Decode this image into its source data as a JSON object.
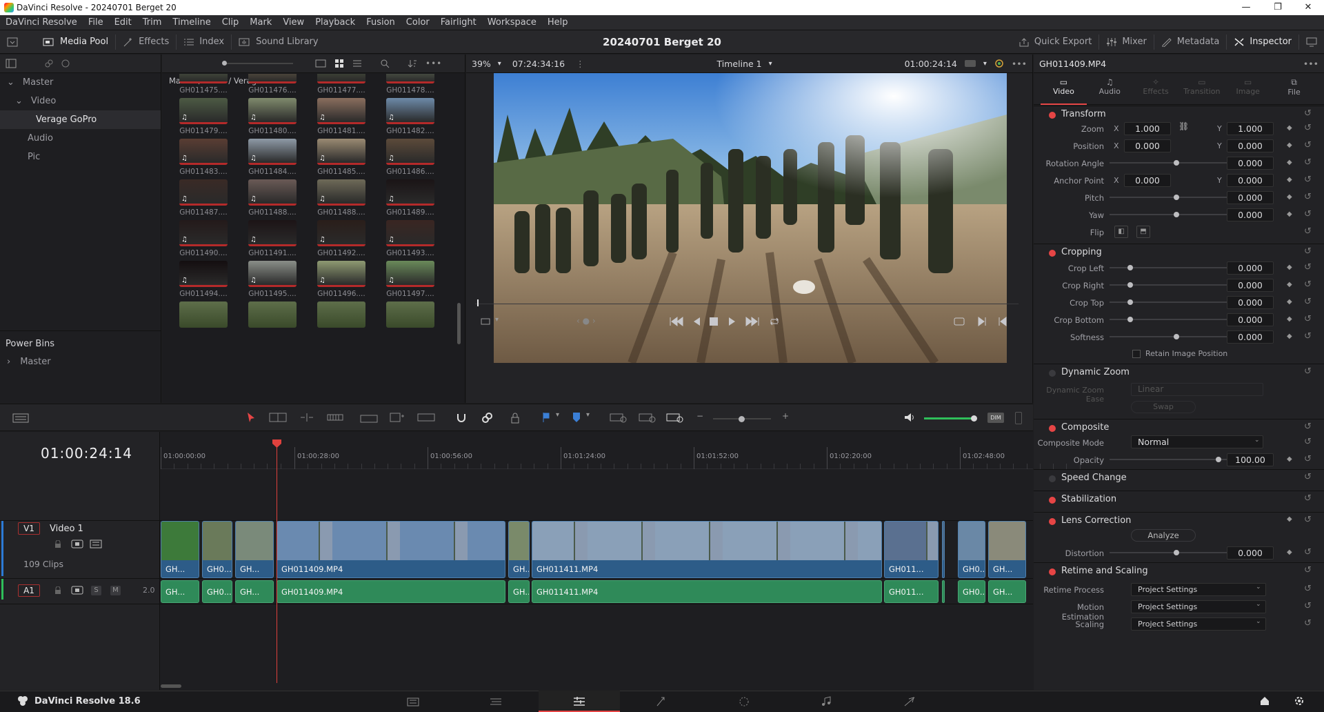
{
  "window": {
    "title": "DaVinci Resolve - 20240701 Berget 20",
    "minimize": "—",
    "maximize": "❐",
    "close": "✕"
  },
  "menu": [
    "DaVinci Resolve",
    "File",
    "Edit",
    "Trim",
    "Timeline",
    "Clip",
    "Mark",
    "View",
    "Playback",
    "Fusion",
    "Color",
    "Fairlight",
    "Workspace",
    "Help"
  ],
  "toolbar": {
    "media_pool": "Media Pool",
    "effects": "Effects",
    "index": "Index",
    "sound_library": "Sound Library",
    "project_title": "20240701 Berget 20",
    "quick_export": "Quick Export",
    "mixer": "Mixer",
    "metadata": "Metadata",
    "inspector": "Inspector"
  },
  "viewer": {
    "zoom": "39%",
    "source_tc": "07:24:34:16",
    "timeline_name": "Timeline 1",
    "record_tc": "01:00:24:14"
  },
  "bins": {
    "master": "Master",
    "video": "Video",
    "selected": "Verage GoPro",
    "audio": "Audio",
    "pic": "Pic",
    "power_bins": "Power Bins",
    "power_master": "Master"
  },
  "breadcrumb": "Master / Video / Verage GoPro",
  "clips": {
    "row0": [
      "GH011475....",
      "GH011476....",
      "GH011477....",
      "GH011478...."
    ],
    "row1": [
      "GH011479....",
      "GH011480....",
      "GH011481....",
      "GH011482...."
    ],
    "row2": [
      "GH011483....",
      "GH011484....",
      "GH011485....",
      "GH011486...."
    ],
    "row3": [
      "GH011487....",
      "GH011488....",
      "GH011488....",
      "GH011489...."
    ],
    "row4": [
      "GH011490....",
      "GH011491....",
      "GH011492....",
      "GH011493...."
    ],
    "row5": [
      "GH011494....",
      "GH011495....",
      "GH011496....",
      "GH011497...."
    ]
  },
  "inspector": {
    "clip_name": "GH011409.MP4",
    "tabs": [
      "Video",
      "Audio",
      "Effects",
      "Transition",
      "Image",
      "File"
    ],
    "transform": {
      "title": "Transform",
      "zoom": "Zoom",
      "zoom_x": "1.000",
      "zoom_y": "1.000",
      "position": "Position",
      "pos_x": "0.000",
      "pos_y": "0.000",
      "rotation": "Rotation Angle",
      "rotation_val": "0.000",
      "anchor": "Anchor Point",
      "anchor_x": "0.000",
      "anchor_y": "0.000",
      "pitch": "Pitch",
      "pitch_val": "0.000",
      "yaw": "Yaw",
      "yaw_val": "0.000",
      "flip": "Flip",
      "x": "X",
      "y": "Y"
    },
    "cropping": {
      "title": "Cropping",
      "left": "Crop Left",
      "left_val": "0.000",
      "right": "Crop Right",
      "right_val": "0.000",
      "top": "Crop Top",
      "top_val": "0.000",
      "bottom": "Crop Bottom",
      "bottom_val": "0.000",
      "softness": "Softness",
      "softness_val": "0.000",
      "retain": "Retain Image Position"
    },
    "dynamic_zoom": {
      "title": "Dynamic Zoom",
      "ease": "Dynamic Zoom Ease",
      "ease_val": "Linear",
      "swap": "Swap"
    },
    "composite": {
      "title": "Composite",
      "mode": "Composite Mode",
      "mode_val": "Normal",
      "opacity": "Opacity",
      "opacity_val": "100.00"
    },
    "speed": "Speed Change",
    "stabilization": "Stabilization",
    "lens": {
      "title": "Lens Correction",
      "analyze": "Analyze",
      "distortion": "Distortion",
      "distortion_val": "0.000"
    },
    "retime": {
      "title": "Retime and Scaling",
      "process": "Retime Process",
      "process_val": "Project Settings",
      "motion": "Motion Estimation",
      "motion_val": "Project Settings",
      "scaling": "Scaling",
      "scaling_val": "Project Settings"
    }
  },
  "timeline": {
    "timecode": "01:00:24:14",
    "ruler": [
      "01:00:00:00",
      "01:00:28:00",
      "01:00:56:00",
      "01:01:24:00",
      "01:01:52:00",
      "01:02:20:00",
      "01:02:48:00"
    ],
    "v1": "V1",
    "video_track": "Video 1",
    "clip_count": "109 Clips",
    "a1": "A1",
    "a1_level": "2.0",
    "solo": "S",
    "mute": "M",
    "clips_v": [
      "GH...",
      "GH0...",
      "GH...",
      "GH011409.MP4",
      "GH...",
      "GH011411.MP4",
      "GH011...",
      "GH0...",
      "GH..."
    ],
    "clips_a": [
      "GH...",
      "GH0...",
      "GH...",
      "GH011409.MP4",
      "GH...",
      "GH011411.MP4",
      "GH011...",
      "GH0...",
      "GH..."
    ]
  },
  "app": {
    "name": "DaVinci Resolve 18.6"
  },
  "colors": {
    "accent_red": "#e64545",
    "video_clip": "#2d5c88",
    "audio_clip": "#2f8a59",
    "playhead": "#e0413d"
  }
}
